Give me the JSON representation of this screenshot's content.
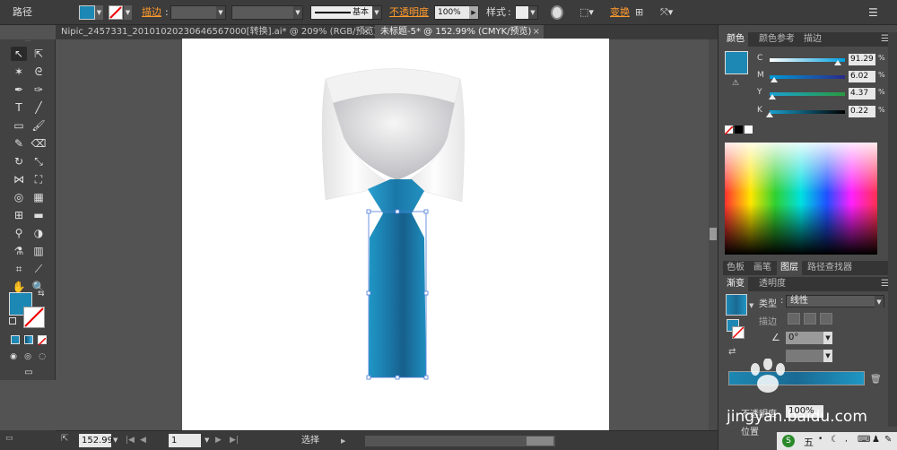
{
  "control_bar": {
    "object_type": "路径",
    "stroke_label": "描边",
    "stroke_profile": "基本",
    "opacity_label": "不透明度",
    "opacity_value": "100%",
    "style_label": "样式",
    "transform_label": "变换"
  },
  "tabs": [
    {
      "label": "Nipic_2457331_20101020230646567000[转换].ai* @ 209% (RGB/预览)",
      "active": false
    },
    {
      "label": "未标题-5* @ 152.99% (CMYK/预览)",
      "active": true
    }
  ],
  "color_panel": {
    "tabs": [
      "颜色",
      "颜色参考",
      "描边"
    ],
    "channels": [
      {
        "name": "C",
        "value": "91.29",
        "unit": "%",
        "fraction": 0.91
      },
      {
        "name": "M",
        "value": "6.02",
        "unit": "%",
        "fraction": 0.06
      },
      {
        "name": "Y",
        "value": "4.37",
        "unit": "%",
        "fraction": 0.04
      },
      {
        "name": "K",
        "value": "0.22",
        "unit": "%",
        "fraction": 0.0
      }
    ]
  },
  "mid_panel": {
    "tabs": [
      "色板",
      "画笔",
      "图层",
      "路径查找器"
    ]
  },
  "gradient_panel": {
    "tabs": [
      "渐变",
      "透明度"
    ],
    "type_label": "类型",
    "type_value": "线性",
    "stroke_label": "描边",
    "angle_value": "0°",
    "opacity_label": "不透明度",
    "opacity_value": "100%",
    "position_label": "位置"
  },
  "status": {
    "zoom": "152.99",
    "page": "1",
    "mode": "选择"
  },
  "watermark": {
    "text": "jingyan.baidu.com"
  },
  "colors": {
    "tie_main": "#1a6f9a",
    "tie_light": "#2a9ccd",
    "accent": "#ff9a2e",
    "fill_swatch": "#1d88b3"
  }
}
